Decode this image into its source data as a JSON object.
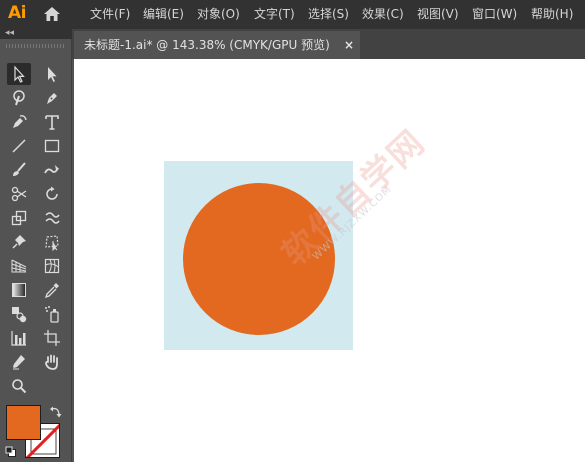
{
  "app": {
    "logo": "Ai"
  },
  "menu": [
    {
      "label": "文件(F)"
    },
    {
      "label": "编辑(E)"
    },
    {
      "label": "对象(O)"
    },
    {
      "label": "文字(T)"
    },
    {
      "label": "选择(S)"
    },
    {
      "label": "效果(C)"
    },
    {
      "label": "视图(V)"
    },
    {
      "label": "窗口(W)"
    },
    {
      "label": "帮助(H)"
    }
  ],
  "document_tab": {
    "title": "未标题-1.ai* @ 143.38% (CMYK/GPU 预览)",
    "close": "×"
  },
  "panel": {
    "collapse": "◂◂"
  },
  "toolbar": {
    "tools": [
      "selection-icon",
      "direct-selection-icon",
      "magic-wand-icon",
      "pen-icon",
      "curvature-icon",
      "type-icon",
      "line-segment-icon",
      "rectangle-icon",
      "paintbrush-icon",
      "shaper-icon",
      "scissors-icon",
      "rotate-icon",
      "scale-icon",
      "warp-icon",
      "puppet-warp-icon",
      "free-transform-icon",
      "perspective-grid-icon",
      "mesh-icon",
      "gradient-icon",
      "eyedropper-icon",
      "blend-icon",
      "symbol-sprayer-icon",
      "column-graph-icon",
      "artboard-icon",
      "slice-icon",
      "hand-icon",
      "zoom-icon"
    ]
  },
  "colors": {
    "fill": "#e2691f",
    "stroke": "none",
    "artboard_bg": "#d2e9ef",
    "circle": "#e2691f",
    "accent_logo": "#ff9a00"
  },
  "watermark": {
    "text": "软件自学网",
    "url": "WWW.RJZXW.COM"
  }
}
